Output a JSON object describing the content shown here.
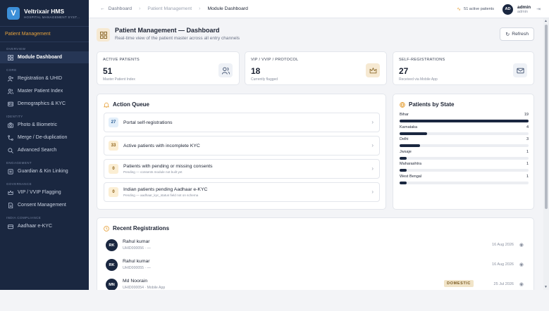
{
  "brand": {
    "name": "Veltrixair HMS",
    "subtitle": "HOSPITAL MANAGEMENT SYST...",
    "logo_letter": "V"
  },
  "module_label": "Patient Management",
  "sidebar": {
    "overview_label": "OVERVIEW",
    "core_label": "CORE",
    "identity_label": "IDENTITY",
    "engagement_label": "ENGAGEMENT",
    "governance_label": "GOVERNANCE",
    "compliance_label": "INDIA COMPLIANCE",
    "items": [
      {
        "label": "Module Dashboard",
        "icon": "grid-icon",
        "active": true
      },
      {
        "label": "Registration & UHID",
        "icon": "user-plus-icon"
      },
      {
        "label": "Master Patient Index",
        "icon": "users-icon"
      },
      {
        "label": "Demographics & KYC",
        "icon": "id-card-icon"
      },
      {
        "label": "Photo & Biometric",
        "icon": "camera-icon"
      },
      {
        "label": "Merge / De-duplication",
        "icon": "merge-icon"
      },
      {
        "label": "Advanced Search",
        "icon": "search-icon"
      },
      {
        "label": "Guardian & Kin Linking",
        "icon": "link-icon"
      },
      {
        "label": "VIP / VVIP Flagging",
        "icon": "crown-icon"
      },
      {
        "label": "Consent Management",
        "icon": "document-icon"
      },
      {
        "label": "Aadhaar e-KYC",
        "icon": "card-icon"
      }
    ]
  },
  "topbar": {
    "back": "Dashboard",
    "crumb_mid": "Patient Management",
    "crumb_current": "Module Dashboard",
    "active_patients": "51 active patients",
    "avatar_initials": "AD",
    "user_name": "admin",
    "user_role": "admin"
  },
  "page": {
    "title": "Patient Management — Dashboard",
    "subtitle": "Real-time view of the patient master across all entry channels",
    "refresh_label": "Refresh"
  },
  "stats": [
    {
      "label": "ACTIVE PATIENTS",
      "value": "51",
      "sub": "Master Patient Index",
      "icon": "users-icon"
    },
    {
      "label": "VIP / VVIP / PROTOCOL",
      "value": "18",
      "sub": "Currently flagged",
      "icon": "crown-icon"
    },
    {
      "label": "SELF-REGISTRATIONS",
      "value": "27",
      "sub": "Received via Mobile App",
      "icon": "mail-icon"
    }
  ],
  "action_queue": {
    "title": "Action Queue",
    "items": [
      {
        "count": "27",
        "label": "Portal self-registrations",
        "note": "",
        "color": "blue"
      },
      {
        "count": "33",
        "label": "Active patients with incomplete KYC",
        "note": "",
        "color": "amber"
      },
      {
        "count": "0",
        "label": "Patients with pending or missing consents",
        "note": "Pending — consents module not built yet",
        "color": "amber"
      },
      {
        "count": "0",
        "label": "Indian patients pending Aadhaar e-KYC",
        "note": "Pending — aadhaar_kyc_status field not on schema",
        "color": "amber"
      }
    ]
  },
  "patients_by_state": {
    "title": "Patients by State",
    "max": 19,
    "states": [
      {
        "name": "Bihar",
        "count": 19
      },
      {
        "name": "Karnataka",
        "count": 4
      },
      {
        "name": "Delhi",
        "count": 3
      },
      {
        "name": "Jwsaje",
        "count": 1
      },
      {
        "name": "Maharashtra",
        "count": 1
      },
      {
        "name": "West Bengal",
        "count": 1
      }
    ]
  },
  "recent_registrations": {
    "title": "Recent Registrations",
    "rows": [
      {
        "initials": "RK",
        "name": "Rahul kumar",
        "sub": "UHID000056 · —",
        "date": "16 Aug 2026",
        "tag": ""
      },
      {
        "initials": "RK",
        "name": "Rahul kumar",
        "sub": "UHID000055 · —",
        "date": "16 Aug 2026",
        "tag": ""
      },
      {
        "initials": "MN",
        "name": "Md Noorain",
        "sub": "UHID000054 · Mobile App",
        "date": "25 Jul 2026",
        "tag": "DOMESTIC"
      }
    ]
  }
}
